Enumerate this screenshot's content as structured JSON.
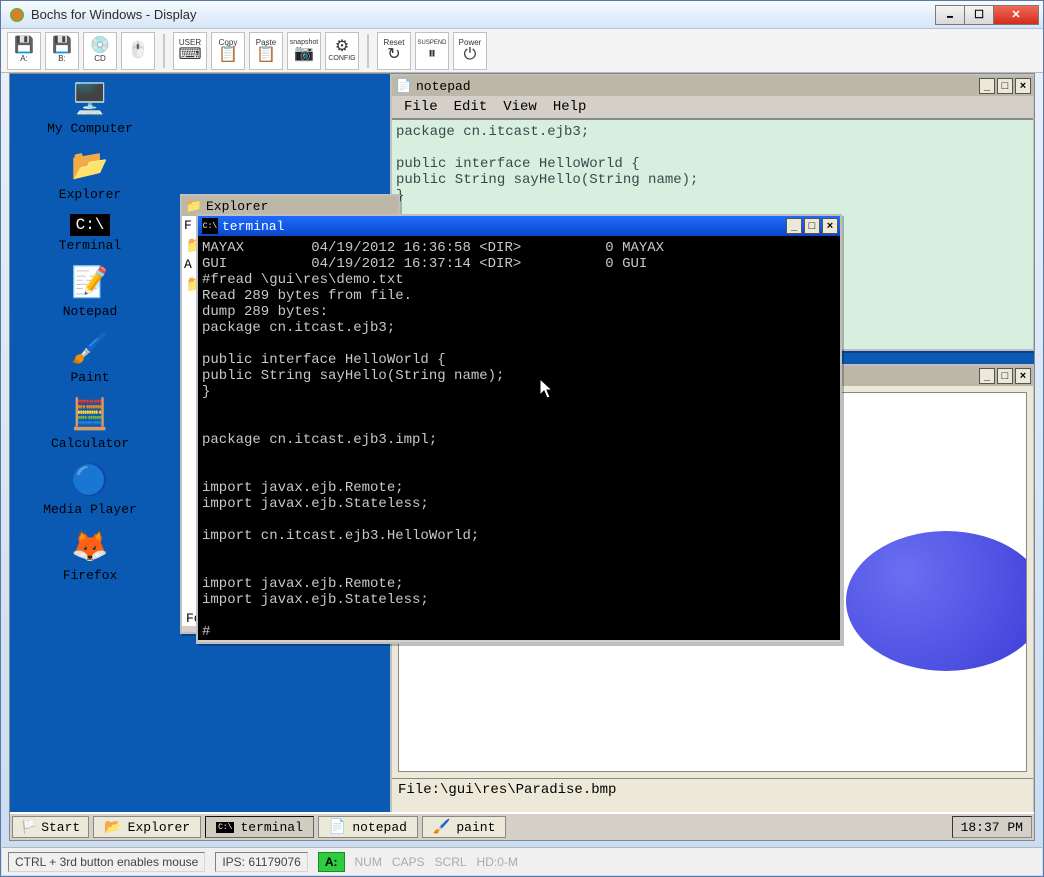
{
  "outer": {
    "title": "Bochs for Windows - Display",
    "toolbar": [
      {
        "name": "floppy-a",
        "label": "A:"
      },
      {
        "name": "floppy-b",
        "label": "B:"
      },
      {
        "name": "cdrom",
        "label": "CD"
      },
      {
        "name": "mouse",
        "label": ""
      },
      {
        "name": "user",
        "label": "USER"
      },
      {
        "name": "copy",
        "label": "Copy"
      },
      {
        "name": "paste",
        "label": "Paste"
      },
      {
        "name": "snapshot",
        "label": "snapshot"
      },
      {
        "name": "config",
        "label": "CONFIG"
      },
      {
        "name": "reset",
        "label": "Reset"
      },
      {
        "name": "suspend",
        "label": "SUSPEND"
      },
      {
        "name": "power",
        "label": "Power"
      }
    ]
  },
  "desktop_icons": [
    {
      "name": "my-computer",
      "glyph": "🖥️",
      "label": "My Computer"
    },
    {
      "name": "explorer",
      "glyph": "📁",
      "label": "Explorer"
    },
    {
      "name": "terminal",
      "glyph": "⬛",
      "label": "Terminal"
    },
    {
      "name": "notepad",
      "glyph": "📄",
      "label": "Notepad"
    },
    {
      "name": "paint",
      "glyph": "🖌️",
      "label": "Paint"
    },
    {
      "name": "calculator",
      "glyph": "🧮",
      "label": "Calculator"
    },
    {
      "name": "media-player",
      "glyph": "⏵",
      "label": "Media Player"
    },
    {
      "name": "firefox",
      "glyph": "🌐",
      "label": "Firefox"
    }
  ],
  "notepad": {
    "title": "notepad",
    "menu": [
      "File",
      "Edit",
      "View",
      "Help"
    ],
    "content": "package cn.itcast.ejb3;\n\npublic interface HelloWorld {\npublic String sayHello(String name);\n}"
  },
  "explorer_win": {
    "title": "Explorer"
  },
  "terminal": {
    "title": "terminal",
    "content": "MAYAX        04/19/2012 16:36:58 <DIR>          0 MAYAX\nGUI          04/19/2012 16:37:14 <DIR>          0 GUI\n#fread \\gui\\res\\demo.txt\nRead 289 bytes from file.\ndump 289 bytes:\npackage cn.itcast.ejb3;\n\npublic interface HelloWorld {\npublic String sayHello(String name);\n}\n\n\npackage cn.itcast.ejb3.impl;\n\n\nimport javax.ejb.Remote;\nimport javax.ejb.Stateless;\n\nimport cn.itcast.ejb3.HelloWorld;\n\n\nimport javax.ejb.Remote;\nimport javax.ejb.Stateless;\n\n#"
  },
  "paint": {
    "status": "File:\\gui\\res\\Paradise.bmp"
  },
  "taskbar": {
    "start": "Start",
    "items": [
      {
        "name": "explorer",
        "glyph": "📁",
        "label": "Explorer",
        "active": false
      },
      {
        "name": "terminal",
        "glyph": "⬛",
        "label": "terminal",
        "active": true
      },
      {
        "name": "notepad",
        "glyph": "📄",
        "label": "notepad",
        "active": false
      },
      {
        "name": "paint",
        "glyph": "🖌️",
        "label": "paint",
        "active": false
      }
    ],
    "clock": "18:37 PM"
  },
  "bochs_status": {
    "mouse_hint": "CTRL + 3rd button enables mouse",
    "ips": "IPS: 61179076",
    "drive": "A:",
    "indicators": [
      "NUM",
      "CAPS",
      "SCRL",
      "HD:0-M"
    ]
  }
}
